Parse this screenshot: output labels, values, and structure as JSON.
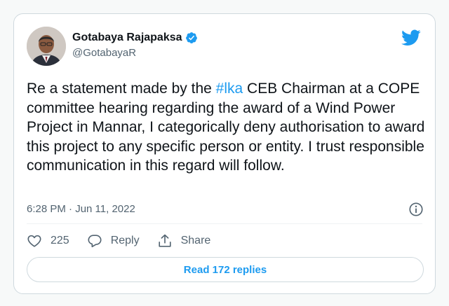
{
  "tweet": {
    "author": {
      "display_name": "Gotabaya Rajapaksa",
      "handle": "@GotabayaR",
      "verified": true,
      "avatar_icon": "profile-photo"
    },
    "text_before": "Re a statement made by the ",
    "hashtag": "#lka",
    "text_after": " CEB Chairman at a COPE committee hearing regarding the award of a Wind Power Project in Mannar, I categorically deny authorisation to award this project to any specific person or entity. I trust responsible communication in this regard will follow.",
    "timestamp": "6:28 PM · Jun 11, 2022",
    "likes_count": "225",
    "reply_label": "Reply",
    "share_label": "Share",
    "read_replies_label": "Read 172 replies"
  },
  "icons": {
    "brand": "twitter-bird-icon",
    "verified": "verified-badge-icon",
    "info": "info-icon",
    "like": "heart-icon",
    "reply": "reply-bubble-icon",
    "share": "share-icon"
  },
  "colors": {
    "accent": "#1d9bf0",
    "text": "#0f1419",
    "muted": "#536471",
    "border": "#cfd9de"
  }
}
